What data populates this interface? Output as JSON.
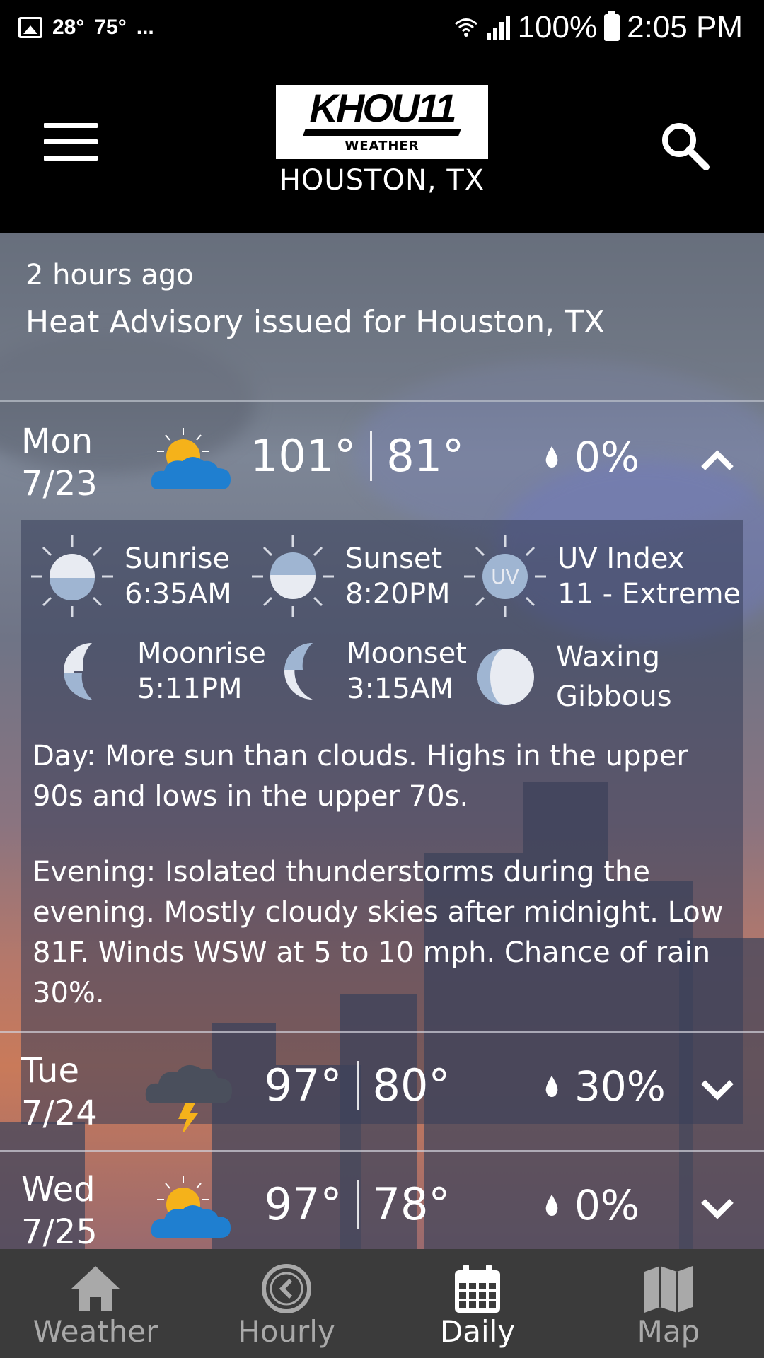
{
  "status_bar": {
    "temp1": "28°",
    "temp2": "75°",
    "more": "...",
    "battery": "100%",
    "time": "2:05 PM"
  },
  "header": {
    "logo_text": "KHOU11",
    "logo_sub": "WEATHER",
    "location": "HOUSTON, TX"
  },
  "alert": {
    "time": "2 hours ago",
    "title": "Heat Advisory issued for Houston, TX"
  },
  "days": [
    {
      "dow": "Mon",
      "date": "7/23",
      "icon": "partly-sunny-icon",
      "high": "101°",
      "low": "81°",
      "precip": "0%",
      "expanded": true
    },
    {
      "dow": "Tue",
      "date": "7/24",
      "icon": "thunderstorm-icon",
      "high": "97°",
      "low": "80°",
      "precip": "30%",
      "expanded": false
    },
    {
      "dow": "Wed",
      "date": "7/25",
      "icon": "partly-sunny-icon",
      "high": "97°",
      "low": "78°",
      "precip": "0%",
      "expanded": false
    }
  ],
  "details": {
    "sunrise_label": "Sunrise",
    "sunrise_value": "6:35AM",
    "sunset_label": "Sunset",
    "sunset_value": "8:20PM",
    "uv_label": "UV Index",
    "uv_value": "11 - Extreme",
    "uv_badge": "UV",
    "moonrise_label": "Moonrise",
    "moonrise_value": "5:11PM",
    "moonset_label": "Moonset",
    "moonset_value": "3:15AM",
    "phase_line1": "Waxing",
    "phase_line2": "Gibbous",
    "day_text": "Day: More sun than clouds. Highs in the upper 90s and lows in the upper 70s.",
    "evening_text": "Evening: Isolated thunderstorms during the evening. Mostly cloudy skies after midnight. Low 81F. Winds WSW at 5 to 10 mph. Chance of rain 30%."
  },
  "nav": {
    "weather": "Weather",
    "hourly": "Hourly",
    "daily": "Daily",
    "map": "Map",
    "active": "daily"
  },
  "colors": {
    "cloud_blue": "#1f7fd0",
    "sun_yellow": "#f5b21a",
    "storm_cloud": "#4a4f5c",
    "nav_bg": "#3b3b3b"
  }
}
